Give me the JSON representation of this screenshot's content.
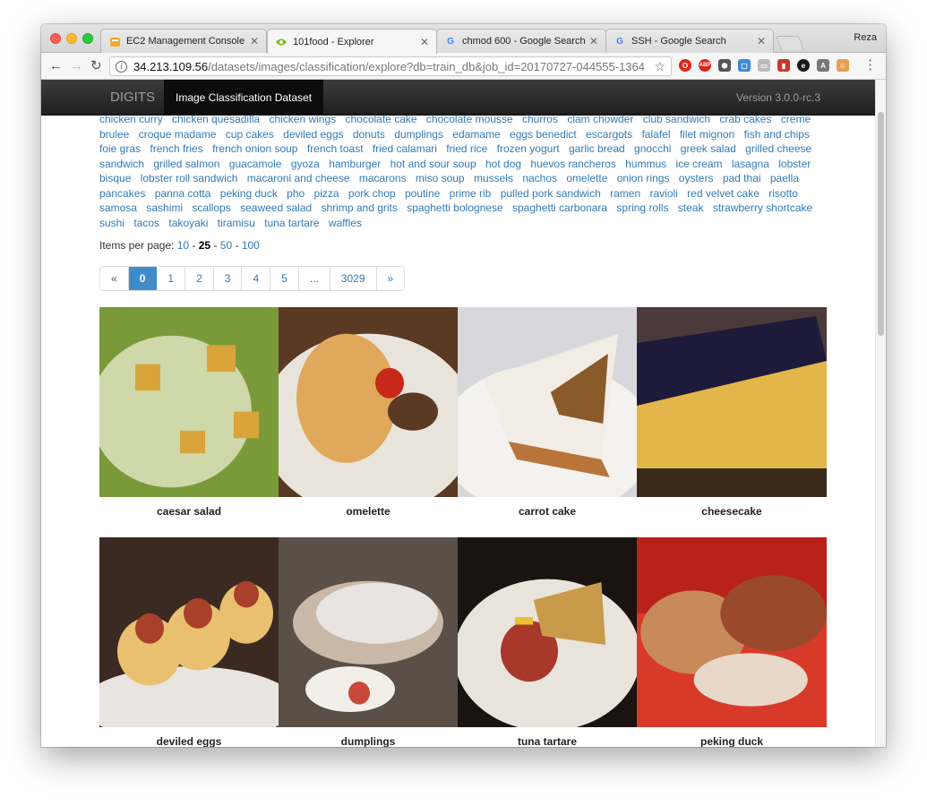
{
  "browser": {
    "tabs": [
      {
        "title": "EC2 Management Console",
        "icon": "aws-icon",
        "active": false
      },
      {
        "title": "101food - Explorer",
        "icon": "nvidia-icon",
        "active": true
      },
      {
        "title": "chmod 600 - Google Search",
        "icon": "google-icon",
        "active": false
      },
      {
        "title": "SSH - Google Search",
        "icon": "google-icon",
        "active": false
      }
    ],
    "profile_name": "Reza",
    "url_host": "34.213.109.56",
    "url_path": "/datasets/images/classification/explore?db=train_db&job_id=20170727-044555-1364"
  },
  "navbar": {
    "brand": "DIGITS",
    "active_item": "Image Classification Dataset",
    "version": "Version 3.0.0-rc.3"
  },
  "categories": [
    "chicken curry",
    "chicken quesadilla",
    "chicken wings",
    "chocolate cake",
    "chocolate mousse",
    "churros",
    "clam chowder",
    "club sandwich",
    "crab cakes",
    "creme brulee",
    "croque madame",
    "cup cakes",
    "deviled eggs",
    "donuts",
    "dumplings",
    "edamame",
    "eggs benedict",
    "escargots",
    "falafel",
    "filet mignon",
    "fish and chips",
    "foie gras",
    "french fries",
    "french onion soup",
    "french toast",
    "fried calamari",
    "fried rice",
    "frozen yogurt",
    "garlic bread",
    "gnocchi",
    "greek salad",
    "grilled cheese sandwich",
    "grilled salmon",
    "guacamole",
    "gyoza",
    "hamburger",
    "hot and sour soup",
    "hot dog",
    "huevos rancheros",
    "hummus",
    "ice cream",
    "lasagna",
    "lobster bisque",
    "lobster roll sandwich",
    "macaroni and cheese",
    "macarons",
    "miso soup",
    "mussels",
    "nachos",
    "omelette",
    "onion rings",
    "oysters",
    "pad thai",
    "paella",
    "pancakes",
    "panna cotta",
    "peking duck",
    "pho",
    "pizza",
    "pork chop",
    "poutine",
    "prime rib",
    "pulled pork sandwich",
    "ramen",
    "ravioli",
    "red velvet cake",
    "risotto",
    "samosa",
    "sashimi",
    "scallops",
    "seaweed salad",
    "shrimp and grits",
    "spaghetti bolognese",
    "spaghetti carbonara",
    "spring rolls",
    "steak",
    "strawberry shortcake",
    "sushi",
    "tacos",
    "takoyaki",
    "tiramisu",
    "tuna tartare",
    "waffles"
  ],
  "items_per_page": {
    "label": "Items per page:",
    "options": [
      "10",
      "25",
      "50",
      "100"
    ],
    "selected": "25",
    "separator": "-"
  },
  "pagination": {
    "prev": "«",
    "pages": [
      "0",
      "1",
      "2",
      "3",
      "4",
      "5",
      "...",
      "3029"
    ],
    "active": "0",
    "next": "»"
  },
  "images": [
    {
      "label": "caesar salad",
      "palette": [
        "#cfd8a8",
        "#7a9a3a",
        "#d9a43a"
      ]
    },
    {
      "label": "omelette",
      "palette": [
        "#e8e4dc",
        "#e0a85a",
        "#5a3a22"
      ]
    },
    {
      "label": "carrot cake",
      "palette": [
        "#d8d8dc",
        "#f2ede4",
        "#b8743a"
      ]
    },
    {
      "label": "cheesecake",
      "palette": [
        "#4a3a3a",
        "#e2b64a",
        "#1e1a3a"
      ]
    },
    {
      "label": "deviled eggs",
      "palette": [
        "#3a2a22",
        "#e8c070",
        "#a8402a"
      ]
    },
    {
      "label": "dumplings",
      "palette": [
        "#5a5048",
        "#e8e4e0",
        "#c8b8a8"
      ]
    },
    {
      "label": "tuna tartare",
      "palette": [
        "#1a1410",
        "#e8e4dc",
        "#c89a4a"
      ]
    },
    {
      "label": "peking duck",
      "palette": [
        "#b8221a",
        "#c88a5a",
        "#e8d8c8"
      ]
    }
  ]
}
